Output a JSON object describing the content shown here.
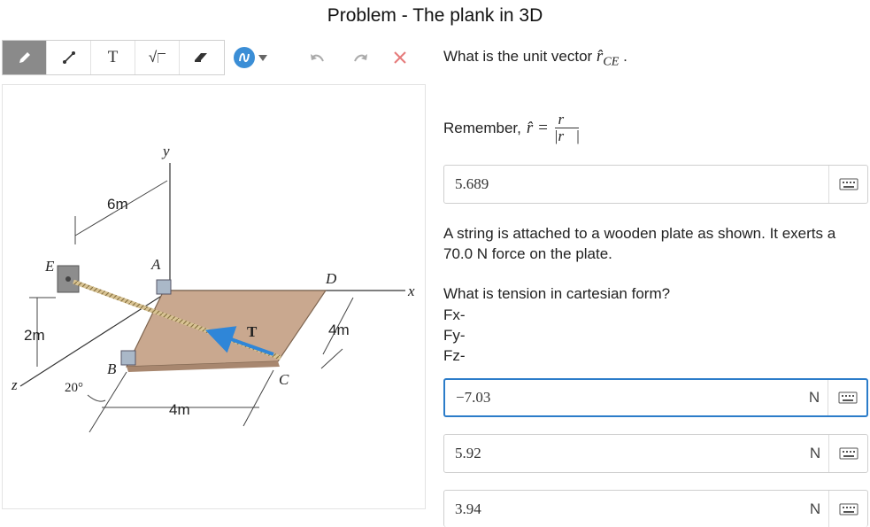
{
  "header": {
    "title": "Problem - The plank in 3D"
  },
  "toolbar": {
    "text_tool_label": "T",
    "sqrt_tool_label": "√"
  },
  "figure": {
    "labels": {
      "y": "y",
      "x": "x",
      "z": "z",
      "E": "E",
      "A": "A",
      "B": "B",
      "C": "C",
      "D": "D",
      "T": "T",
      "dim_6m": "6m",
      "dim_2m": "2m",
      "dim_4m_side": "4m",
      "dim_4m_bottom": "4m",
      "angle": "20°"
    },
    "colors": {
      "plank": "#c9a88f",
      "rope": "#d8c393",
      "force": "#2f86d8"
    }
  },
  "panel": {
    "q1_text": "What is the unit vector",
    "q1_subscript": "CE",
    "q1_suffix": ".",
    "remember_label": "Remember,",
    "answer1": {
      "value": "5.689"
    },
    "description": "A string is attached to a wooden plate as shown. It exerts a 70.0 N force on the plate.",
    "q2_text": "What is tension in cartesian form?",
    "fx_label": "Fx-",
    "fy_label": "Fy-",
    "fz_label": "Fz-",
    "fx_answer": {
      "value": "−7.03",
      "unit": "N"
    },
    "fy_answer": {
      "value": "5.92",
      "unit": "N"
    },
    "fz_answer": {
      "value": "3.94",
      "unit": "N"
    }
  }
}
